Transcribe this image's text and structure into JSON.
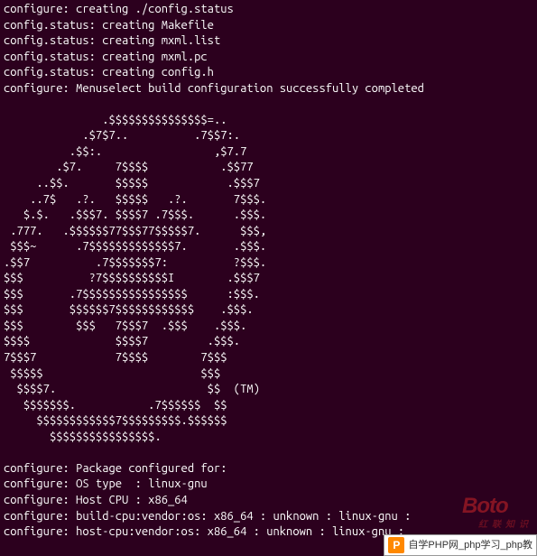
{
  "terminal": {
    "lines": [
      "configure: creating ./config.status",
      "config.status: creating Makefile",
      "config.status: creating mxml.list",
      "config.status: creating mxml.pc",
      "config.status: creating config.h",
      "configure: Menuselect build configuration successfully completed",
      "",
      "               .$$$$$$$$$$$$$$$=..      ",
      "            .$7$7..          .7$$7:.    ",
      "          .$$:.                 ,$7.7   ",
      "        .$7.     7$$$$           .$$77  ",
      "     ..$$.       $$$$$            .$$$7 ",
      "    ..7$   .?.   $$$$$   .?.       7$$$.",
      "   $.$.   .$$$7. $$$$7 .7$$$.      .$$$.",
      " .777.   .$$$$$$77$$$77$$$$$7.      $$$,",
      " $$$~      .7$$$$$$$$$$$$$7.       .$$$.",
      ".$$7          .7$$$$$$$7:          ?$$$.",
      "$$$          ?7$$$$$$$$$$I        .$$$7 ",
      "$$$       .7$$$$$$$$$$$$$$$$      :$$$. ",
      "$$$       $$$$$$7$$$$$$$$$$$$    .$$$.  ",
      "$$$        $$$   7$$$7  .$$$    .$$$.   ",
      "$$$$             $$$$7         .$$$.    ",
      "7$$$7            7$$$$        7$$$      ",
      " $$$$$                        $$$       ",
      "  $$$$7.                       $$  (TM) ",
      "   $$$$$$$.           .7$$$$$$  $$      ",
      "     $$$$$$$$$$$$7$$$$$$$$$.$$$$$$      ",
      "       $$$$$$$$$$$$$$$$.                ",
      "",
      "configure: Package configured for: ",
      "configure: OS type  : linux-gnu",
      "configure: Host CPU : x86_64",
      "configure: build-cpu:vendor:os: x86_64 : unknown : linux-gnu :",
      "configure: host-cpu:vendor:os: x86_64 : unknown : linux-gnu :"
    ]
  },
  "watermark": {
    "text": "Boto",
    "sub": "红联知识"
  },
  "footer": {
    "icon_letter": "P",
    "text": "自学PHP网_php学习_php教"
  }
}
